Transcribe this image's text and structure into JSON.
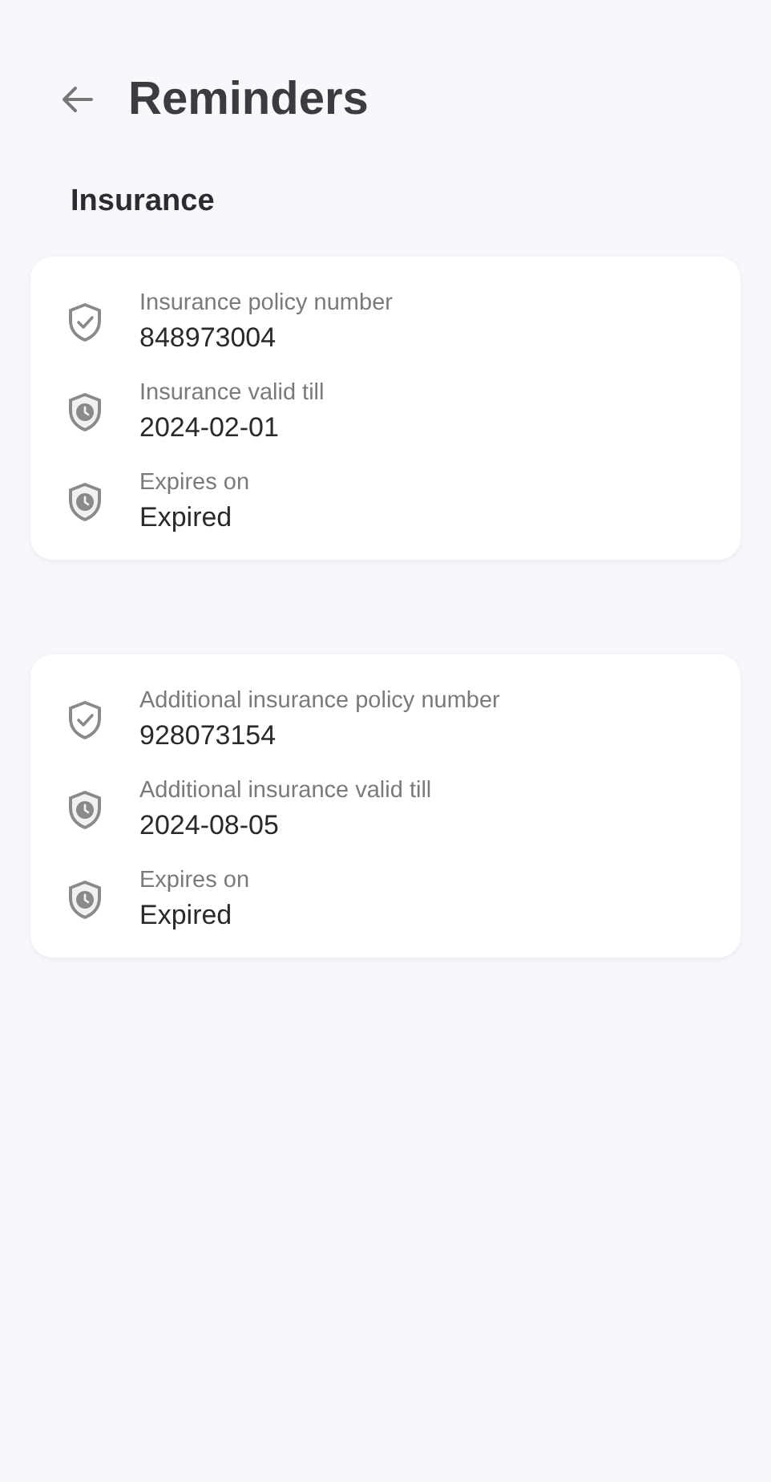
{
  "header": {
    "title": "Reminders"
  },
  "section": {
    "title": "Insurance"
  },
  "cards": [
    {
      "rows": [
        {
          "kind": "policy",
          "label": "Insurance policy number",
          "value": "848973004"
        },
        {
          "kind": "date",
          "label": "Insurance valid till",
          "value": "2024-02-01"
        },
        {
          "kind": "date",
          "label": "Expires on",
          "value": "Expired"
        }
      ]
    },
    {
      "rows": [
        {
          "kind": "policy",
          "label": "Additional insurance policy number",
          "value": "928073154"
        },
        {
          "kind": "date",
          "label": "Additional insurance valid till",
          "value": "2024-08-05"
        },
        {
          "kind": "date",
          "label": "Expires on",
          "value": "Expired"
        }
      ]
    }
  ]
}
